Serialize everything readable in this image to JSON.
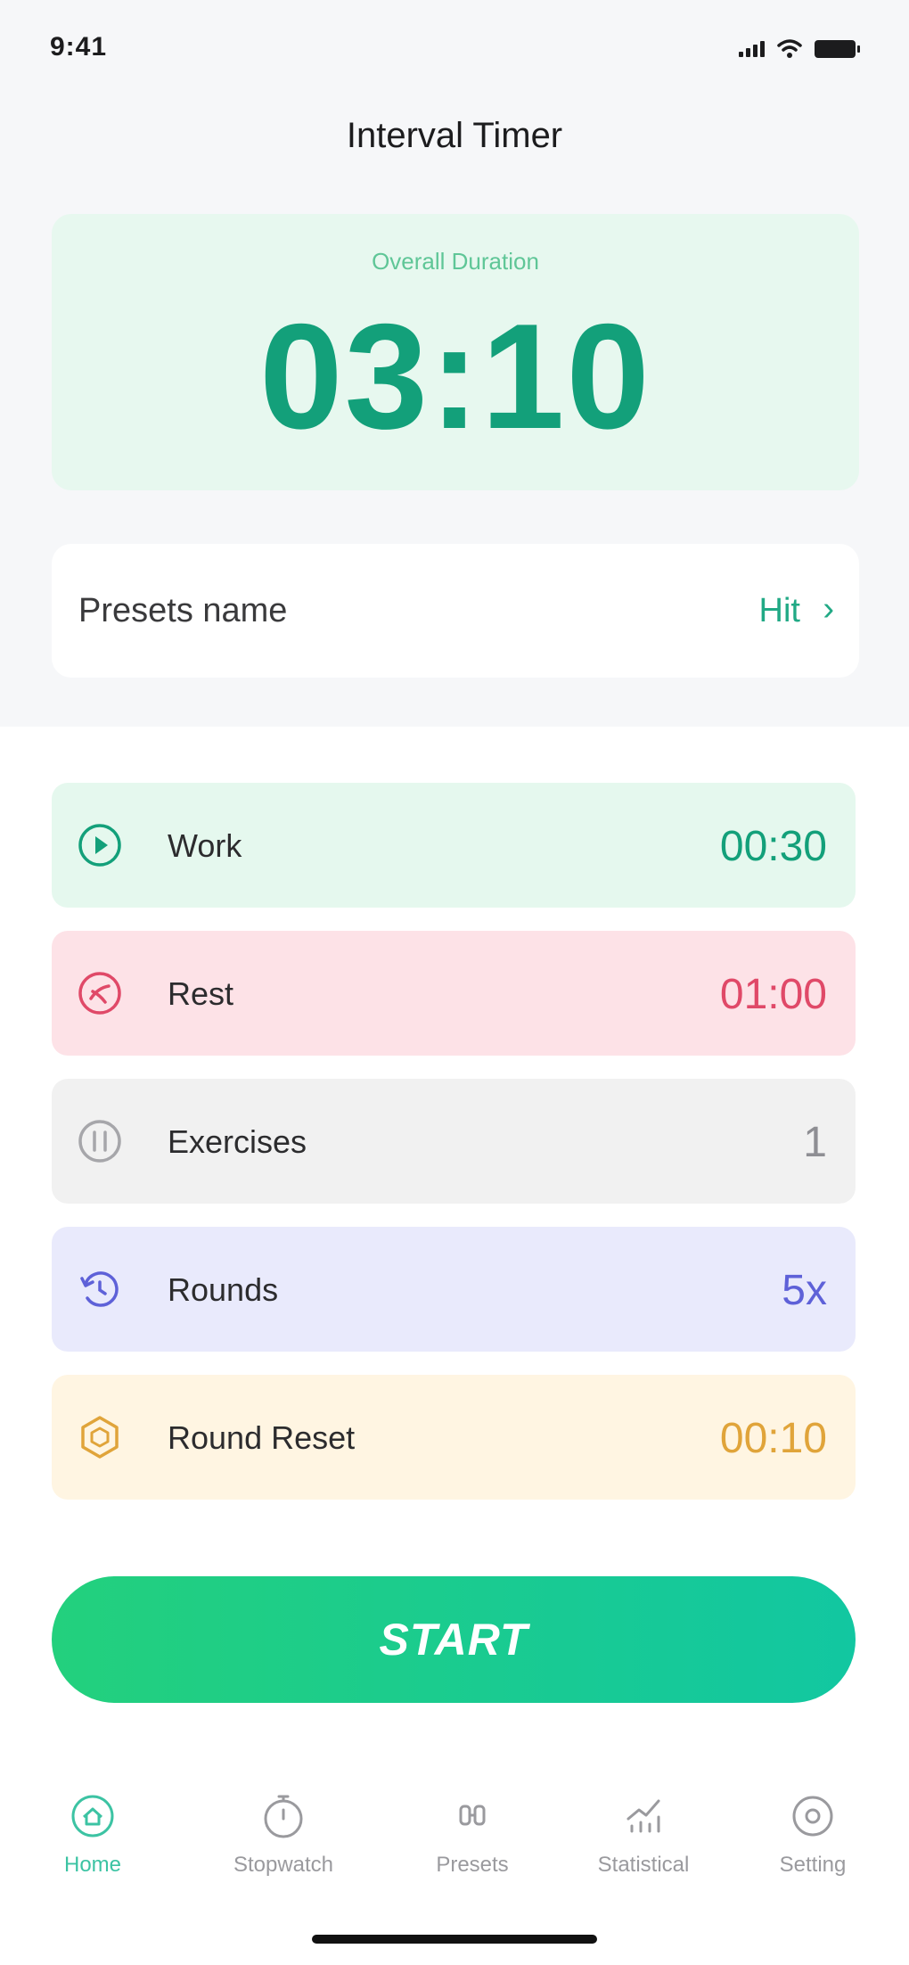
{
  "status_bar": {
    "time": "9:41"
  },
  "header": {
    "title": "Interval Timer"
  },
  "duration": {
    "label": "Overall Duration",
    "value": "03:10"
  },
  "presets": {
    "label": "Presets name",
    "value": "Hit"
  },
  "rows": {
    "work": {
      "label": "Work",
      "value": "00:30",
      "color": "#13a07a",
      "icon": "play-circle-icon"
    },
    "rest": {
      "label": "Rest",
      "value": "01:00",
      "color": "#e04968",
      "icon": "rest-icon"
    },
    "exercises": {
      "label": "Exercises",
      "value": "1",
      "color": "#8e8e93",
      "icon": "exercises-icon"
    },
    "rounds": {
      "label": "Rounds",
      "value": "5x",
      "color": "#5e61d8",
      "icon": "rounds-icon"
    },
    "round_reset": {
      "label": "Round Reset",
      "value": "00:10",
      "color": "#e0a43a",
      "icon": "round-reset-icon"
    }
  },
  "start_button": {
    "label": "START"
  },
  "tabs": [
    {
      "label": "Home",
      "icon": "home-icon",
      "active": true
    },
    {
      "label": "Stopwatch",
      "icon": "stopwatch-icon",
      "active": false
    },
    {
      "label": "Presets",
      "icon": "presets-icon",
      "active": false
    },
    {
      "label": "Statistical",
      "icon": "statistical-icon",
      "active": false
    },
    {
      "label": "Setting",
      "icon": "setting-icon",
      "active": false
    }
  ],
  "colors": {
    "accent": "#13a07a",
    "start_gradient": [
      "#23d07d",
      "#12c7a1"
    ],
    "tab_active": "#3cc3a3",
    "tab_inactive": "#9a9a9e"
  }
}
